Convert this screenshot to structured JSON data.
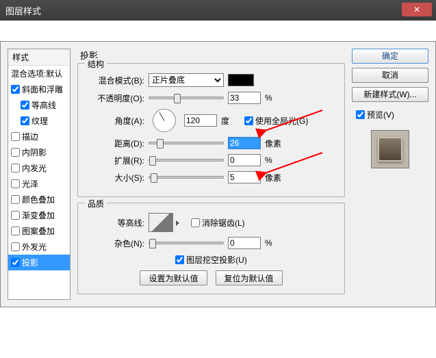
{
  "window": {
    "title": "图层样式"
  },
  "styles": {
    "header": "样式",
    "items": [
      {
        "label": "混合选项:默认",
        "checked": null,
        "indent": false
      },
      {
        "label": "斜面和浮雕",
        "checked": true,
        "indent": false
      },
      {
        "label": "等高线",
        "checked": true,
        "indent": true
      },
      {
        "label": "纹理",
        "checked": true,
        "indent": true
      },
      {
        "label": "描边",
        "checked": false,
        "indent": false
      },
      {
        "label": "内阴影",
        "checked": false,
        "indent": false
      },
      {
        "label": "内发光",
        "checked": false,
        "indent": false
      },
      {
        "label": "光泽",
        "checked": false,
        "indent": false
      },
      {
        "label": "颜色叠加",
        "checked": false,
        "indent": false
      },
      {
        "label": "渐变叠加",
        "checked": false,
        "indent": false
      },
      {
        "label": "图案叠加",
        "checked": false,
        "indent": false
      },
      {
        "label": "外发光",
        "checked": false,
        "indent": false
      },
      {
        "label": "投影",
        "checked": true,
        "indent": false,
        "selected": true
      }
    ]
  },
  "panel": {
    "title": "投影",
    "structure": {
      "legend": "结构",
      "blendmode": {
        "label": "混合模式(B):",
        "value": "正片叠底",
        "swatch": "#000000"
      },
      "opacity": {
        "label": "不透明度(O):",
        "value": "33",
        "unit": "%",
        "thumb": 33
      },
      "angle": {
        "label": "角度(A):",
        "value": "120",
        "unit": "度",
        "globallight": {
          "label": "使用全局光(G)",
          "checked": true
        }
      },
      "distance": {
        "label": "距离(D):",
        "value": "26",
        "unit": "像素",
        "thumb": 26,
        "highlight": true
      },
      "spread": {
        "label": "扩展(R):",
        "value": "0",
        "unit": "%",
        "thumb": 0
      },
      "size": {
        "label": "大小(S):",
        "value": "5",
        "unit": "像素",
        "thumb": 5
      }
    },
    "quality": {
      "legend": "品质",
      "contour": {
        "label": "等高线:",
        "antialias": {
          "label": "消除锯齿(L)",
          "checked": false
        }
      },
      "noise": {
        "label": "杂色(N):",
        "value": "0",
        "unit": "%",
        "thumb": 0
      }
    },
    "knockout": {
      "label": "图层挖空投影(U)",
      "checked": true
    },
    "defaults": {
      "set": "设置为默认值",
      "reset": "复位为默认值"
    }
  },
  "buttons": {
    "ok": "确定",
    "cancel": "取消",
    "newstyle": "新建样式(W)...",
    "preview": {
      "label": "预览(V)",
      "checked": true
    }
  }
}
